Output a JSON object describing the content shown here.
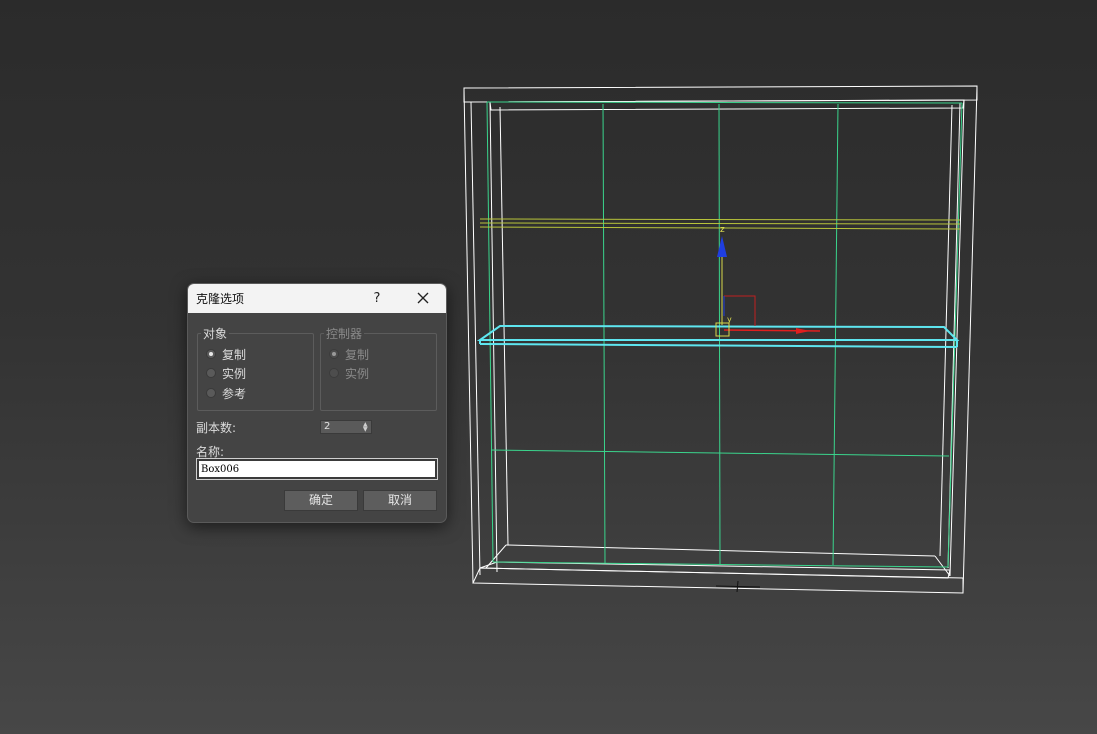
{
  "dialog": {
    "title": "克隆选项",
    "help_label": "?",
    "object_group": {
      "legend": "对象",
      "options": [
        {
          "label": "复制",
          "checked": true
        },
        {
          "label": "实例",
          "checked": false
        },
        {
          "label": "参考",
          "checked": false
        }
      ]
    },
    "controller_group": {
      "legend": "控制器",
      "options": [
        {
          "label": "复制",
          "checked": true
        },
        {
          "label": "实例",
          "checked": false
        }
      ]
    },
    "copies_label": "副本数:",
    "copies_value": "2",
    "name_label": "名称:",
    "name_value": "Box006",
    "ok_label": "确定",
    "cancel_label": "取消"
  },
  "viewport": {
    "gizmo_z_label": "z",
    "gizmo_y_label": "y",
    "colors": {
      "wireframe": "#ffffff",
      "selected": "#5ee6f0",
      "grid": "#3ad48c",
      "other_shelf": "#b8c43a",
      "axis_z": "#1f3ee0",
      "axis_x": "#e01e1e"
    }
  }
}
